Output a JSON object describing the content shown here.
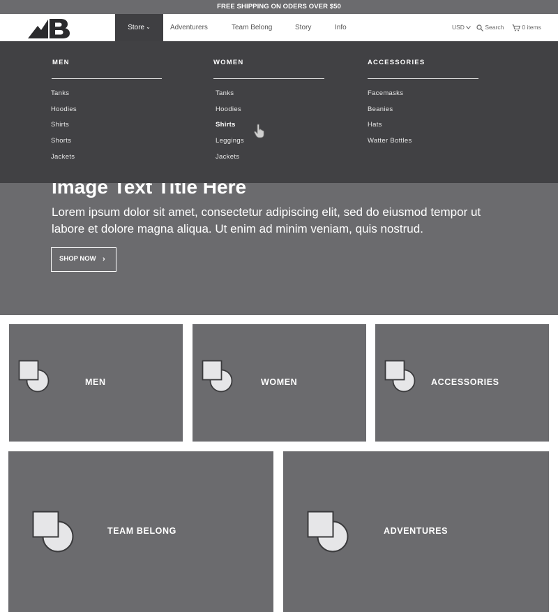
{
  "promo": {
    "text": "FREE SHIPPING ON ODERS OVER $50"
  },
  "header": {
    "logo_icon": "mountain-b-logo-icon",
    "nav": [
      {
        "label": "Store",
        "active": true
      },
      {
        "label": "Adventurers"
      },
      {
        "label": "Team Belong"
      },
      {
        "label": "Story"
      },
      {
        "label": "Info"
      }
    ],
    "currency": "USD",
    "search_label": "Search",
    "cart_label": "0 items"
  },
  "mega_menu": {
    "columns": [
      {
        "heading": "MEN",
        "links": [
          "Tanks",
          "Hoodies",
          "Shirts",
          "Shorts",
          "Jackets"
        ]
      },
      {
        "heading": "WOMEN",
        "links": [
          "Tanks",
          "Hoodies",
          "Shirts",
          "Leggings",
          "Jackets"
        ],
        "active_link": "Shirts"
      },
      {
        "heading": "ACCESSORIES",
        "links": [
          "Facemasks",
          "Beanies",
          "Hats",
          "Watter Bottles"
        ]
      }
    ]
  },
  "hero": {
    "title": "Image Text Title Here",
    "body": "Lorem ipsum dolor sit amet, consectetur adipiscing elit, sed do eiusmod tempor ut labore et dolore magna aliqua. Ut enim ad minim veniam, quis nostrud.",
    "cta_label": "SHOP NOW"
  },
  "tiles": [
    {
      "label": "MEN"
    },
    {
      "label": "WOMEN"
    },
    {
      "label": "ACCESSORIES"
    },
    {
      "label": "TEAM BELONG"
    },
    {
      "label": "ADVENTURES"
    }
  ],
  "colors": {
    "gray": "#6b6b6e",
    "dark_gray": "#414144",
    "placeholder_fill": "#e6e6e8"
  }
}
